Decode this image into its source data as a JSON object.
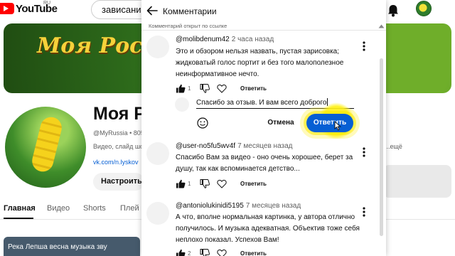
{
  "header": {
    "logo_text": "YouTube",
    "region": "RU",
    "search_value": "зависание"
  },
  "channel": {
    "banner_text": "Моя Росс",
    "name": "Моя Р",
    "handle": "@MyRussia • 805",
    "description": "Видео, слайд шо",
    "description_more": "...ещё",
    "link": "vk.com/n.lyskov",
    "subscribe_label": "Настроить",
    "tabs": [
      {
        "label": "Главная",
        "active": true
      },
      {
        "label": "Видео",
        "active": false
      },
      {
        "label": "Shorts",
        "active": false
      },
      {
        "label": "Плей",
        "active": false
      }
    ],
    "video_title": "Река Лепша весна музыка зву"
  },
  "comments_panel": {
    "title": "Комментарии",
    "link_notice": "Комментарий открыт по ссылке",
    "reply_label": "Ответить",
    "comments": [
      {
        "author": "@molibdenum42",
        "time": "2 часа назад",
        "text": "Это и обзором нельзя назвать, пустая зарисовка; жидковатый голос портит и без того малополезное неинформативное нечто.",
        "likes": "1"
      },
      {
        "author": "@user-no5fu5wv4f",
        "time": "7 месяцев назад",
        "text": "Спасибо Вам за видео - оно очень хорошее, берет за душу, так как вспоминается детство...",
        "likes": "1"
      },
      {
        "author": "@antoniolukinidi5195",
        "time": "7 месяцев назад",
        "text": "А что, вполне нормальная картинка, у автора отлично получилось. И музыка адекватная. Объектив тоже себя неплохо показал. Успехов Вам!",
        "likes": "2"
      }
    ],
    "reply_box": {
      "value": "Спасибо за отзыв. И вам всего доброго",
      "cancel_label": "Отмена",
      "submit_label": "Ответить"
    }
  },
  "colors": {
    "accent_blue": "#065fd4",
    "youtube_red": "#ff0000",
    "highlight_yellow": "#fff000"
  }
}
